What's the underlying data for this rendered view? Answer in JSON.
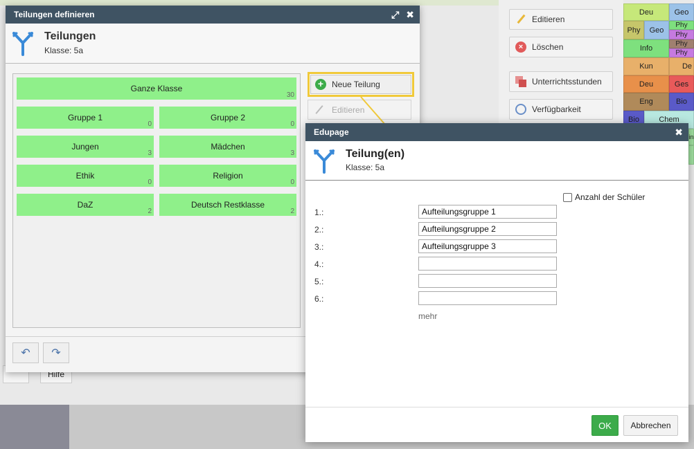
{
  "background": {
    "side_buttons": [
      {
        "label": "Editieren",
        "icon": "pencil-icon"
      },
      {
        "label": "Löschen",
        "icon": "delete-icon"
      },
      {
        "label": "Unterrichtsstunden",
        "icon": "lessons-icon"
      },
      {
        "label": "Verfügbarkeit",
        "icon": "clock-icon"
      }
    ],
    "timetable_cells": [
      "Deu",
      "Geo",
      "Phy",
      "Geo",
      "Phy",
      "Phy",
      "Info",
      "Phy",
      "Phy",
      "Kun",
      "De",
      "Deu",
      "Ges",
      "Eng",
      "Bio",
      "Bio",
      "Chem",
      "in"
    ],
    "help_label": "Hilfe"
  },
  "main_dialog": {
    "window_title": "Teilungen definieren",
    "title": "Teilungen",
    "subtitle": "Klasse: 5a",
    "whole_class": {
      "label": "Ganze Klasse",
      "count": "30"
    },
    "groups": [
      {
        "label": "Gruppe 1",
        "count": "0"
      },
      {
        "label": "Gruppe 2",
        "count": "0"
      },
      {
        "label": "Jungen",
        "count": "3"
      },
      {
        "label": "Mädchen",
        "count": "3"
      },
      {
        "label": "Ethik",
        "count": "0"
      },
      {
        "label": "Religion",
        "count": "0"
      },
      {
        "label": "DaZ",
        "count": "2"
      },
      {
        "label": "Deutsch Restklasse",
        "count": "2"
      }
    ],
    "new_button": "Neue Teilung",
    "edit_button": "Editieren"
  },
  "edupage_dialog": {
    "window_title": "Edupage",
    "title": "Teilung(en)",
    "subtitle": "Klasse: 5a",
    "checkbox_label": "Anzahl der Schüler",
    "rows": [
      {
        "label": "1.:",
        "value": "Aufteilungsgruppe 1"
      },
      {
        "label": "2.:",
        "value": "Aufteilungsgruppe 2"
      },
      {
        "label": "3.:",
        "value": "Aufteilungsgruppe 3"
      },
      {
        "label": "4.:",
        "value": ""
      },
      {
        "label": "5.:",
        "value": ""
      },
      {
        "label": "6.:",
        "value": ""
      }
    ],
    "more_label": "mehr",
    "ok_label": "OK",
    "cancel_label": "Abbrechen"
  },
  "colors": {
    "titlebar": "#3f5363",
    "group_green": "#8ff08a",
    "highlight": "#f0c93a",
    "ok_green": "#3cab4a"
  }
}
